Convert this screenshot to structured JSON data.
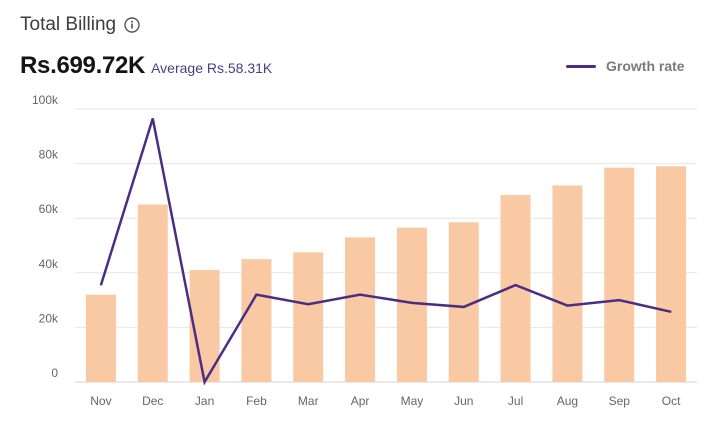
{
  "header": {
    "title": "Total Billing",
    "total": "Rs.699.72K",
    "average": "Average Rs.58.31K"
  },
  "colors": {
    "bar": "#f8c9a3",
    "line": "#4b2e83",
    "grid": "#e6e6e6"
  },
  "chart_data": {
    "type": "bar",
    "categories": [
      "Nov",
      "Dec",
      "Jan",
      "Feb",
      "Mar",
      "Apr",
      "May",
      "Jun",
      "Jul",
      "Aug",
      "Sep",
      "Oct"
    ],
    "values": [
      32000,
      65000,
      41000,
      45000,
      47500,
      53000,
      56500,
      58500,
      68500,
      72000,
      78500,
      79000
    ],
    "line_series": {
      "name": "Growth rate",
      "values": [
        35500,
        96500,
        0,
        32000,
        28500,
        32000,
        29000,
        27500,
        35500,
        28000,
        30000,
        25700
      ]
    },
    "yticks": [
      0,
      20000,
      40000,
      60000,
      80000,
      100000
    ],
    "ytick_labels": [
      "0",
      "20k",
      "40k",
      "60k",
      "80k",
      "100k"
    ],
    "ylim": [
      0,
      100000
    ],
    "grid": true,
    "legend_position": "top-right"
  }
}
